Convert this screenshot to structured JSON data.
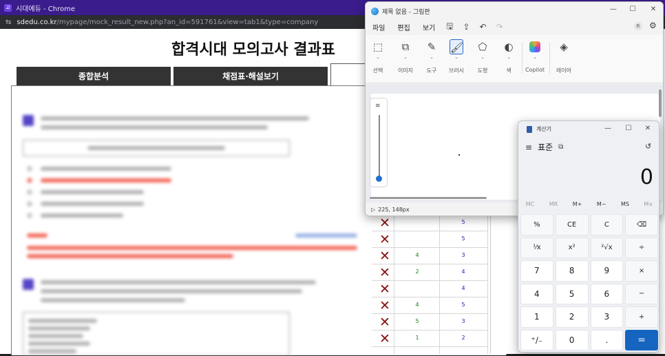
{
  "chrome": {
    "window_title": "시대에듀 - Chrome",
    "url_host": "sdedu.co.kr",
    "url_path": "/mypage/mock_result_new.php?an_id=591761&view=tab1&type=company"
  },
  "page": {
    "title": "합격시대 모의고사 결과표",
    "tabs": [
      "종합분석",
      "채점표·해설보기",
      ""
    ]
  },
  "answer_table": {
    "rows": [
      {
        "mine": "",
        "answer": "5"
      },
      {
        "mine": "",
        "answer": "5"
      },
      {
        "mine": "4",
        "answer": "3"
      },
      {
        "mine": "2",
        "answer": "4"
      },
      {
        "mine": "",
        "answer": "4"
      },
      {
        "mine": "4",
        "answer": "5"
      },
      {
        "mine": "5",
        "answer": "3"
      },
      {
        "mine": "1",
        "answer": "2"
      }
    ],
    "mark_icon": "x-mark-icon",
    "mark_color": "#8b1111"
  },
  "paint": {
    "title": "제목 없음 - 그림판",
    "menu": [
      "파일",
      "편집",
      "보기"
    ],
    "tools": [
      {
        "label": "선택",
        "icon": "select-icon"
      },
      {
        "label": "이미지",
        "icon": "image-icon"
      },
      {
        "label": "도구",
        "icon": "tools-icon"
      },
      {
        "label": "브러시",
        "icon": "brush-icon"
      },
      {
        "label": "도형",
        "icon": "shapes-icon"
      },
      {
        "label": "색",
        "icon": "color-icon"
      },
      {
        "label": "Copilot",
        "icon": "copilot-icon"
      },
      {
        "label": "레이어",
        "icon": "layers-icon"
      }
    ],
    "status_position": "225, 148px"
  },
  "calculator": {
    "title": "계산기",
    "mode": "표준",
    "display": "0",
    "memory": [
      "MC",
      "MR",
      "M+",
      "M−",
      "MS",
      "M∨"
    ],
    "keys": [
      "%",
      "CE",
      "C",
      "⌫",
      "¹⁄x",
      "x²",
      "²√x",
      "÷",
      "7",
      "8",
      "9",
      "×",
      "4",
      "5",
      "6",
      "−",
      "1",
      "2",
      "3",
      "+",
      "⁺∕₋",
      "0",
      ".",
      "="
    ],
    "accent": "#1565c0"
  }
}
